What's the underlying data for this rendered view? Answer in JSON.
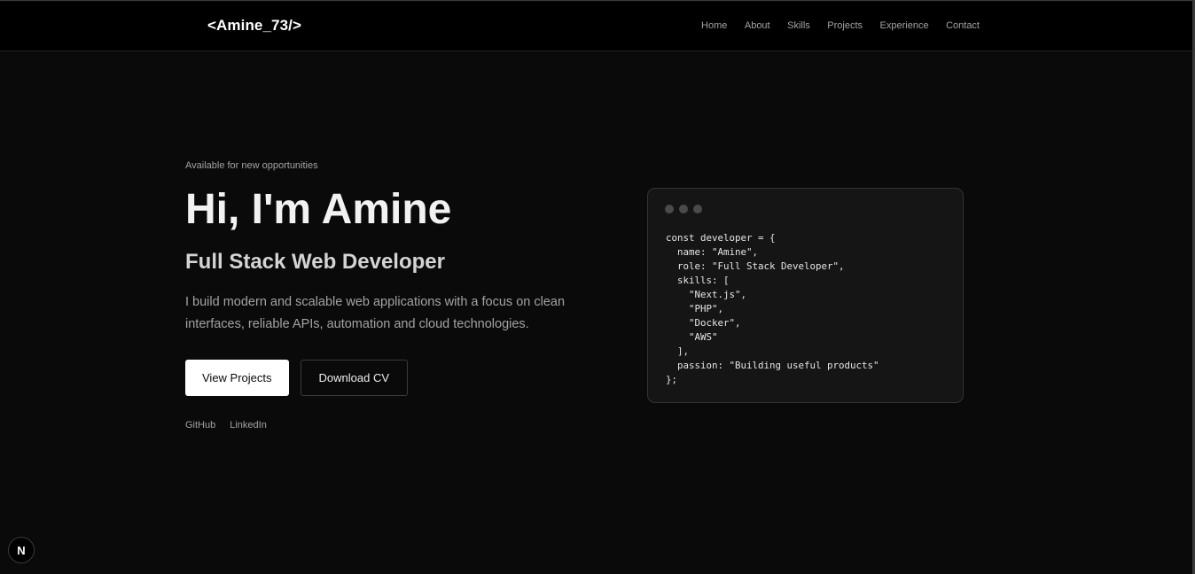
{
  "header": {
    "logo": "<Amine_73/>",
    "nav": [
      "Home",
      "About",
      "Skills",
      "Projects",
      "Experience",
      "Contact"
    ]
  },
  "hero": {
    "badge": "Available for new opportunities",
    "title": "Hi, I'm Amine",
    "subtitle": "Full Stack Web Developer",
    "description": "I build modern and scalable web applications with a focus on clean interfaces, reliable APIs, automation and cloud technologies.",
    "primary_button": "View Projects",
    "secondary_button": "Download CV",
    "socials": [
      "GitHub",
      "LinkedIn"
    ]
  },
  "code_window": {
    "code": "const developer = {\n  name: \"Amine\",\n  role: \"Full Stack Developer\",\n  skills: [\n    \"Next.js\",\n    \"PHP\",\n    \"Docker\",\n    \"AWS\"\n  ],\n  passion: \"Building useful products\"\n};"
  },
  "dev_badge": {
    "letter": "N"
  },
  "colors": {
    "background": "#0a0a0a",
    "header": "#000000",
    "text_primary": "#f2f2f2",
    "text_muted": "#a3a3a3",
    "code_bg": "#151515"
  }
}
